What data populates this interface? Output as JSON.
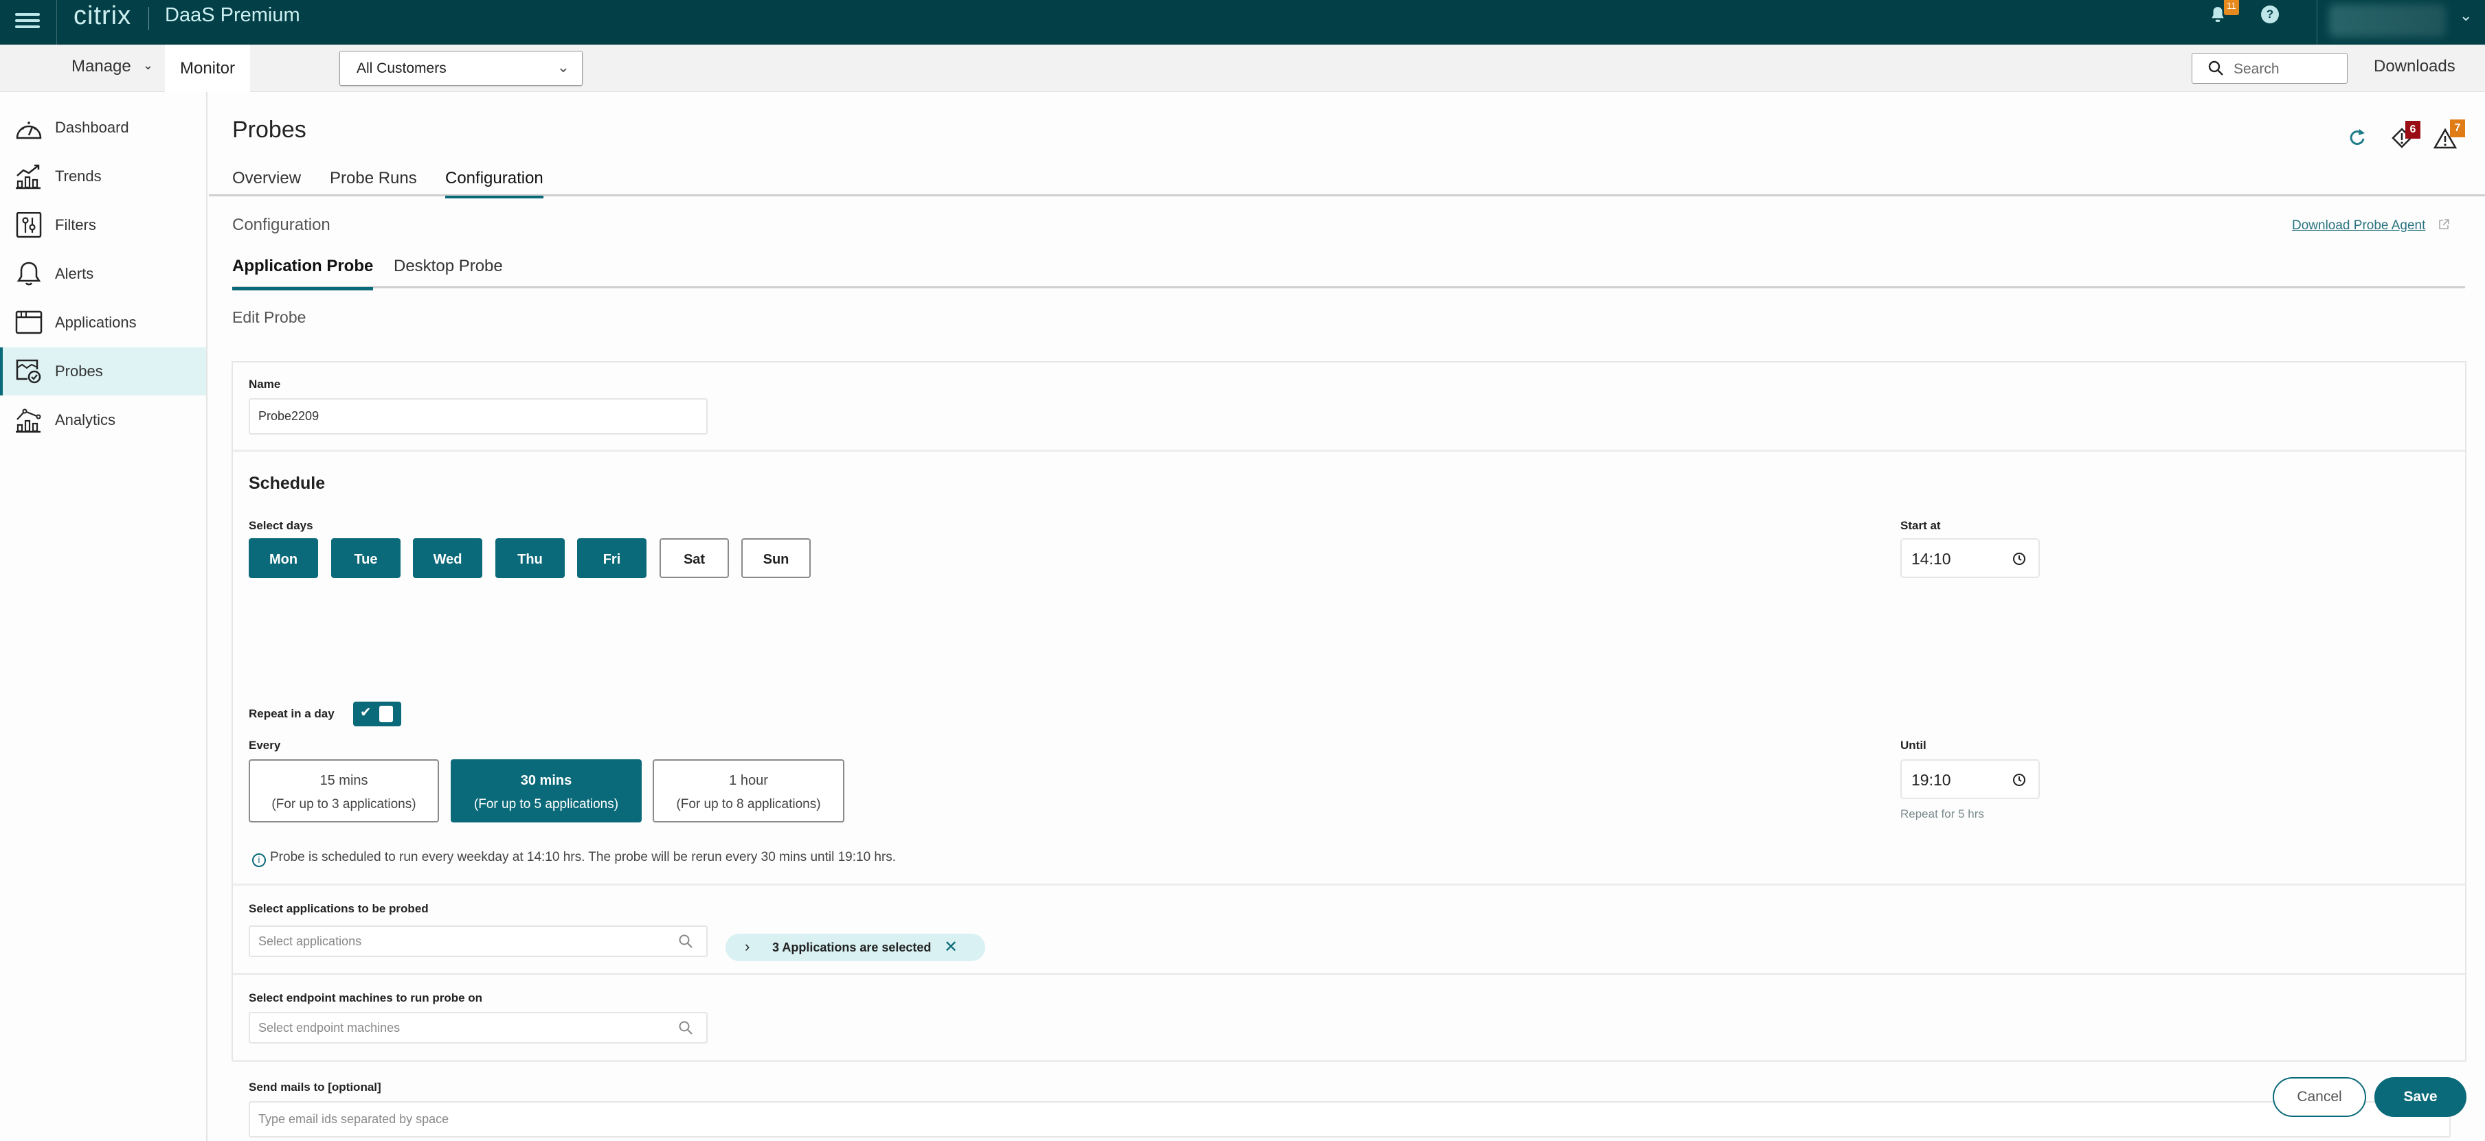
{
  "topbar": {
    "brand": "citrix",
    "product": "DaaS Premium",
    "notifications_count": "11",
    "help_label": "?"
  },
  "subbar": {
    "manage_label": "Manage",
    "monitor_label": "Monitor",
    "customer_select": "All Customers",
    "search_placeholder": "Search",
    "downloads_label": "Downloads"
  },
  "sidebar": {
    "items": [
      {
        "label": "Dashboard",
        "icon": "dashboard-gauge-icon"
      },
      {
        "label": "Trends",
        "icon": "trends-chart-icon"
      },
      {
        "label": "Filters",
        "icon": "filters-sliders-icon"
      },
      {
        "label": "Alerts",
        "icon": "bell-icon"
      },
      {
        "label": "Applications",
        "icon": "application-window-icon"
      },
      {
        "label": "Probes",
        "icon": "probe-check-icon",
        "active": true
      },
      {
        "label": "Analytics",
        "icon": "analytics-chart-icon"
      }
    ]
  },
  "page": {
    "title": "Probes",
    "tabs": [
      "Overview",
      "Probe Runs",
      "Configuration"
    ],
    "active_tab": "Configuration",
    "critical_alerts_count": "6",
    "warning_alerts_count": "7",
    "section_label": "Configuration",
    "download_link": "Download Probe Agent",
    "probe_tabs": [
      "Application Probe",
      "Desktop Probe"
    ],
    "active_probe_tab": "Application Probe",
    "edit_label": "Edit Probe"
  },
  "form": {
    "name_label": "Name",
    "name_value": "Probe2209",
    "schedule_title": "Schedule",
    "select_days_label": "Select days",
    "days": [
      {
        "label": "Mon",
        "selected": true
      },
      {
        "label": "Tue",
        "selected": true
      },
      {
        "label": "Wed",
        "selected": true
      },
      {
        "label": "Thu",
        "selected": true
      },
      {
        "label": "Fri",
        "selected": true
      },
      {
        "label": "Sat",
        "selected": false
      },
      {
        "label": "Sun",
        "selected": false
      }
    ],
    "start_at_label": "Start at",
    "start_at_value": "14:10",
    "repeat_label": "Repeat in a day",
    "repeat_enabled": true,
    "every_label": "Every",
    "intervals": [
      {
        "title": "15 mins",
        "subtitle": "(For up to 3 applications)",
        "selected": false
      },
      {
        "title": "30 mins",
        "subtitle": "(For up to 5 applications)",
        "selected": true
      },
      {
        "title": "1 hour",
        "subtitle": "(For up to 8 applications)",
        "selected": false
      }
    ],
    "until_label": "Until",
    "until_value": "19:10",
    "repeat_hint": "Repeat for 5 hrs",
    "info_text": "Probe is scheduled to run every weekday at 14:10 hrs. The probe will be rerun every 30 mins until 19:10 hrs.",
    "apps_label": "Select applications to be probed",
    "apps_placeholder": "Select applications",
    "apps_chip": "3 Applications are selected",
    "endpoints_label": "Select endpoint machines to run probe on",
    "endpoints_placeholder": "Select endpoint machines",
    "mail_label": "Send mails to [optional]",
    "mail_placeholder": "Type email ids separated by space"
  },
  "actions": {
    "cancel": "Cancel",
    "save": "Save"
  },
  "colors": {
    "topbar": "#033f47",
    "accent": "#0b6a79",
    "active_nav_bg": "#dff3f4",
    "critical_badge": "#9b0d14",
    "warning_badge": "#e07b16",
    "notification_badge": "#e58a1f"
  }
}
